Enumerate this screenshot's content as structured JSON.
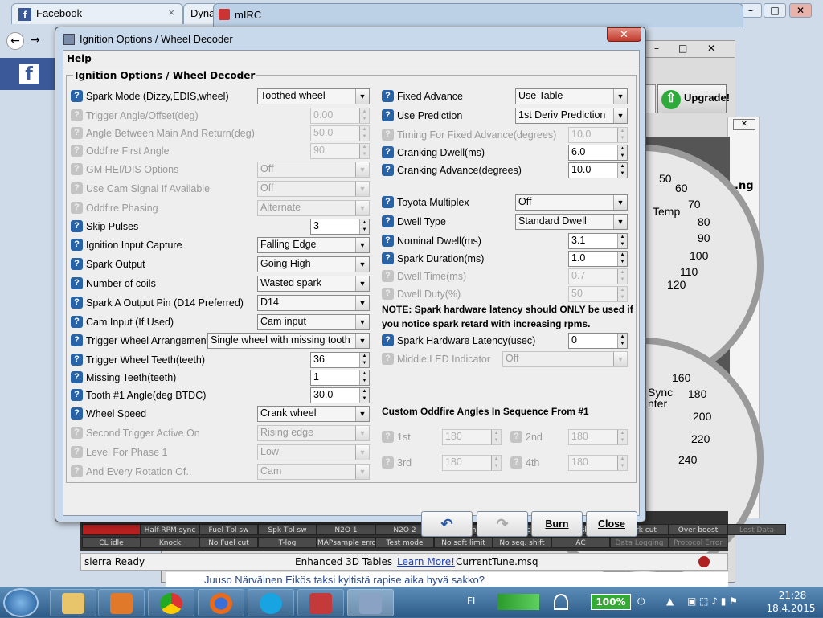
{
  "browser": {
    "tabs": [
      "Facebook",
      "Dyna",
      "mIRC"
    ],
    "close_glyph": "×",
    "fb_letter": "f"
  },
  "background_app": {
    "upgrade": "Upgrade!",
    "gauge_top_numbers": [
      "50",
      "60",
      "70",
      "80",
      "90",
      "100",
      "110",
      "120"
    ],
    "gauge_top_label": "Temp",
    "gauge_bottom_numbers": [
      "160",
      "180",
      "200",
      "220",
      "240"
    ],
    "gauge_bottom_labels": [
      "Sync",
      "nter"
    ],
    "side_text": [
      ".ng",
      "ak"
    ],
    "status_cells_row1": [
      "Half-RPM sync",
      "Fuel Tbl sw",
      "Spk Tbl sw",
      "N2O 1",
      "N2O 2",
      "Hard limit",
      "Launch",
      "Flat shift",
      "Spark cut",
      "Over boost",
      "Lost Data"
    ],
    "status_cells_row2": [
      "CL idle",
      "Knock",
      "No Fuel cut",
      "T-log",
      "MAPsample error!",
      "Test mode",
      "No soft limit",
      "No seq. shift",
      "AC",
      "Data Logging",
      "Protocol Error"
    ],
    "status_left": "sierra Ready",
    "status_mid": "Enhanced 3D Tables",
    "status_link": "Learn More!",
    "status_file": "CurrentTune.msq",
    "chat_line": "Juuso Närväinen Eikös taksi kyltistä rapise aika hyvä sakko?"
  },
  "taskbar": {
    "lang": "FI",
    "battery": "100%",
    "time": "21:28",
    "date": "18.4.2015"
  },
  "dialog": {
    "title": "Ignition Options / Wheel Decoder",
    "close": "✕",
    "menu_help": "Help",
    "group_title": "Ignition Options / Wheel Decoder",
    "left": {
      "spark_mode": {
        "label": "Spark Mode (Dizzy,EDIS,wheel)",
        "value": "Toothed wheel"
      },
      "trigger_angle": {
        "label": "Trigger Angle/Offset(deg)",
        "value": "0.00"
      },
      "angle_between": {
        "label": "Angle Between Main And Return(deg)",
        "value": "50.0"
      },
      "oddfire_first": {
        "label": "Oddfire First Angle",
        "value": "90"
      },
      "gm_hei": {
        "label": "GM HEI/DIS Options",
        "value": "Off"
      },
      "use_cam": {
        "label": "Use Cam Signal If Available",
        "value": "Off"
      },
      "oddfire_phasing": {
        "label": "Oddfire Phasing",
        "value": "Alternate"
      },
      "skip_pulses": {
        "label": "Skip Pulses",
        "value": "3"
      },
      "ign_input": {
        "label": "Ignition Input Capture",
        "value": "Falling Edge"
      },
      "spark_output": {
        "label": "Spark Output",
        "value": "Going High"
      },
      "num_coils": {
        "label": "Number of coils",
        "value": "Wasted spark"
      },
      "spark_a_pin": {
        "label": "Spark A Output Pin (D14 Preferred)",
        "value": "D14"
      },
      "cam_input": {
        "label": "Cam Input (If Used)",
        "value": "Cam input"
      },
      "trigger_arr": {
        "label": "Trigger Wheel Arrangement",
        "value": "Single wheel with missing tooth"
      },
      "trigger_teeth": {
        "label": "Trigger Wheel Teeth(teeth)",
        "value": "36"
      },
      "missing_teeth": {
        "label": "Missing Teeth(teeth)",
        "value": "1"
      },
      "tooth1": {
        "label": "Tooth #1 Angle(deg BTDC)",
        "value": "30.0"
      },
      "wheel_speed": {
        "label": "Wheel Speed",
        "value": "Crank wheel"
      },
      "second_trigger": {
        "label": "Second Trigger Active On",
        "value": "Rising edge"
      },
      "level_phase": {
        "label": "Level For Phase 1",
        "value": "Low"
      },
      "every_rotation": {
        "label": "And Every Rotation Of..",
        "value": "Cam"
      }
    },
    "right": {
      "fixed_adv": {
        "label": "Fixed Advance",
        "value": "Use Table"
      },
      "use_pred": {
        "label": "Use Prediction",
        "value": "1st Deriv Prediction"
      },
      "timing_fixed": {
        "label": "Timing For Fixed Advance(degrees)",
        "value": "10.0"
      },
      "crank_dwell": {
        "label": "Cranking Dwell(ms)",
        "value": "6.0"
      },
      "crank_adv": {
        "label": "Cranking Advance(degrees)",
        "value": "10.0"
      },
      "toyota": {
        "label": "Toyota Multiplex",
        "value": "Off"
      },
      "dwell_type": {
        "label": "Dwell Type",
        "value": "Standard Dwell"
      },
      "nominal_dwell": {
        "label": "Nominal Dwell(ms)",
        "value": "3.1"
      },
      "spark_duration": {
        "label": "Spark Duration(ms)",
        "value": "1.0"
      },
      "dwell_time": {
        "label": "Dwell Time(ms)",
        "value": "0.7"
      },
      "dwell_duty": {
        "label": "Dwell Duty(%)",
        "value": "50"
      },
      "note_line1": "NOTE: Spark hardware latency should ONLY be used if",
      "note_line2": "you notice spark retard with increasing rpms.",
      "hw_latency": {
        "label": "Spark Hardware Latency(usec)",
        "value": "0"
      },
      "middle_led": {
        "label": "Middle LED Indicator",
        "value": "Off"
      },
      "oddfire_title": "Custom Oddfire Angles In Sequence From #1",
      "odd": [
        {
          "label": "1st",
          "value": "180"
        },
        {
          "label": "2nd",
          "value": "180"
        },
        {
          "label": "3rd",
          "value": "180"
        },
        {
          "label": "4th",
          "value": "180"
        }
      ]
    },
    "buttons": {
      "burn": "Burn",
      "close": "Close"
    }
  },
  "icons": [
    "help-icon",
    "undo-icon",
    "redo-icon",
    "close-icon",
    "facebook-icon",
    "start-icon"
  ]
}
